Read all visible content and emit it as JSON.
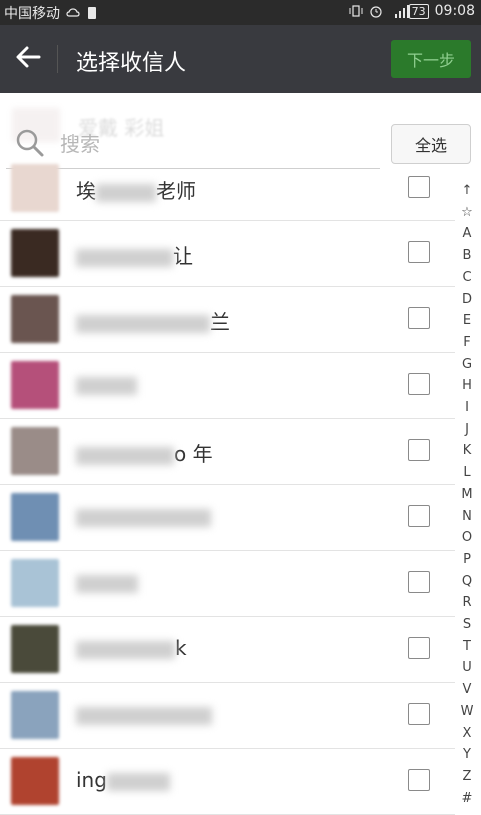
{
  "status_bar": {
    "carrier": "中国移动",
    "battery": "73",
    "time": "09:08",
    "network": "4G"
  },
  "title_bar": {
    "title": "选择收信人",
    "next_label": "下一步"
  },
  "search": {
    "placeholder": "搜索",
    "select_all_label": "全选",
    "ghost_text": "爱戴  彩姐"
  },
  "contacts": [
    {
      "visible_prefix": "埃",
      "visible_suffix": "老师",
      "avatar_color": "#e8d7d0"
    },
    {
      "visible_prefix": "",
      "visible_suffix": "让",
      "avatar_color": "#3a2a22"
    },
    {
      "visible_prefix": "",
      "visible_suffix": "兰",
      "avatar_color": "#6a5550"
    },
    {
      "visible_prefix": "",
      "visible_suffix": "",
      "avatar_color": "#b5507a"
    },
    {
      "visible_prefix": "",
      "visible_suffix": "o  年",
      "avatar_color": "#9a8c88"
    },
    {
      "visible_prefix": "",
      "visible_suffix": "",
      "avatar_color": "#6f8fb3"
    },
    {
      "visible_prefix": "",
      "visible_suffix": "",
      "avatar_color": "#a9c3d6"
    },
    {
      "visible_prefix": "",
      "visible_suffix": "k",
      "avatar_color": "#4a4a3a"
    },
    {
      "visible_prefix": "",
      "visible_suffix": "",
      "avatar_color": "#8aa3bd"
    },
    {
      "visible_prefix": "ing",
      "visible_suffix": "",
      "avatar_color": "#b0432f"
    }
  ],
  "index_letters": [
    "↑",
    "☆",
    "A",
    "B",
    "C",
    "D",
    "E",
    "F",
    "G",
    "H",
    "I",
    "J",
    "K",
    "L",
    "M",
    "N",
    "O",
    "P",
    "Q",
    "R",
    "S",
    "T",
    "U",
    "V",
    "W",
    "X",
    "Y",
    "Z",
    "#"
  ],
  "colors": {
    "titlebar": "#393a3f",
    "accent_green": "#2b7a2b"
  }
}
